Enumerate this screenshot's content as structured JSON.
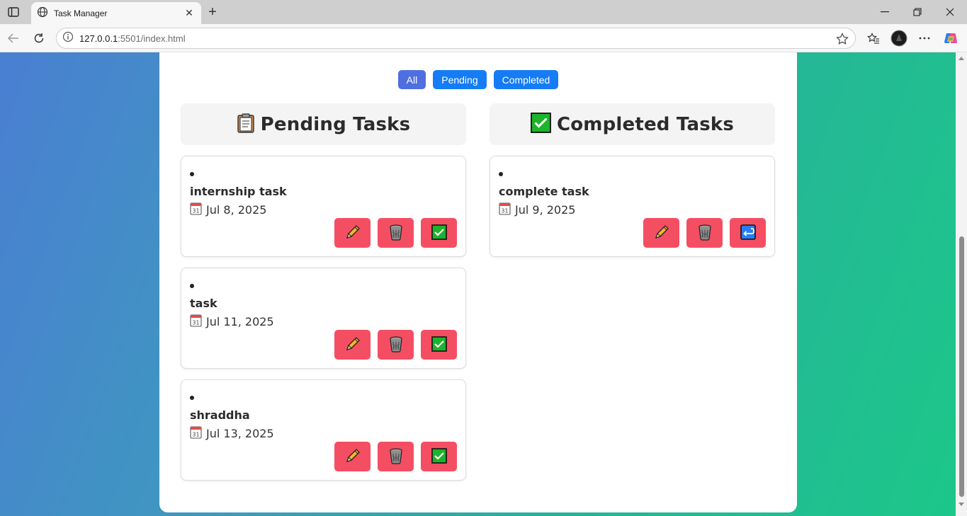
{
  "browser": {
    "tab_title": "Task Manager",
    "tab_close": "✕",
    "new_tab": "+",
    "url_host": "127.0.0.1",
    "url_rest": ":5501/index.html",
    "window_controls": {
      "minimize": "—",
      "restore": "❐",
      "close": "✕"
    }
  },
  "filters": [
    {
      "label": "All",
      "active": true
    },
    {
      "label": "Pending",
      "active": false
    },
    {
      "label": "Completed",
      "active": false
    }
  ],
  "pending": {
    "heading": "Pending Tasks",
    "icon": "clipboard-icon",
    "tasks": [
      {
        "title": "internship task",
        "date": "Jul 8, 2025"
      },
      {
        "title": "task",
        "date": "Jul 11, 2025"
      },
      {
        "title": "shraddha",
        "date": "Jul 13, 2025"
      }
    ]
  },
  "completed": {
    "heading": "Completed Tasks",
    "icon": "check-mark-icon",
    "tasks": [
      {
        "title": "complete task",
        "date": "Jul 9, 2025"
      }
    ]
  },
  "colors": {
    "accent": "#157cf5",
    "active_filter": "#4f6fe0",
    "action_button": "#f44e63",
    "gradient_start": "#4a7fd2",
    "gradient_end": "#1cc789"
  }
}
